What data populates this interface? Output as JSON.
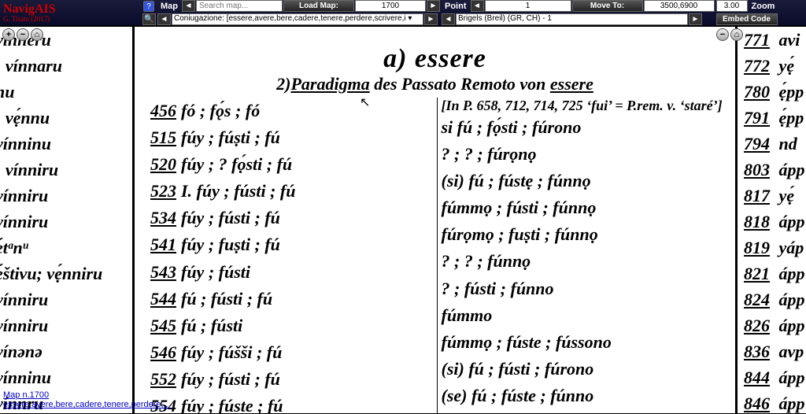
{
  "logo": {
    "title": "NavigAIS",
    "sub": "G. Tisato (2017)"
  },
  "toolbar": {
    "map_label": "Map",
    "search_placeholder": "Search map...",
    "load_map_btn": "Load Map:",
    "map_number": "1700",
    "point_label": "Point",
    "point_value": "1",
    "move_to_btn": "Move To:",
    "coords": "3500,6900",
    "zoom_value": "3.00",
    "zoom_label": "Zoom",
    "select_desc": "Coniugazione: [essere,avere,bere,cadere,tenere,perdere,scrivere,i ▾",
    "select_loc": "Brigels (Breil) (GR, CH) - 1",
    "embed_btn": "Embed Code"
  },
  "center": {
    "title_main": "a) essere",
    "title_sub_prefix": "2)",
    "title_sub_u1": "Paradigma",
    "title_sub_mid": " des Passato Remoto von ",
    "title_sub_u2": "essere",
    "left_rows": [
      {
        "n": "456",
        "t": "fó ; fǫ́s ; fó"
      },
      {
        "n": "515",
        "t": "fúy ; fúṣti ; fú"
      },
      {
        "n": "520",
        "t": "fúy ; ? fọ́sti ; fú"
      },
      {
        "n": "523",
        "t": "I. fúy ; fústi ; fú"
      },
      {
        "n": "534",
        "t": "fúy ; fústi ; fú"
      },
      {
        "n": "541",
        "t": "fúy ; fuṣti ; fú"
      },
      {
        "n": "543",
        "t": "fúy ; fústi"
      },
      {
        "n": "544",
        "t": "fú ; fústi ; fú"
      },
      {
        "n": "545",
        "t": "fú ; fústi"
      },
      {
        "n": "546",
        "t": "fúy ; fúšši ; fú"
      },
      {
        "n": "552",
        "t": "fúy ; fústi ; fú"
      },
      {
        "n": "554",
        "t": "fúy ; fúste ; fú"
      }
    ],
    "right_top": "[In P. 658, 712, 714, 725 ‘fui’ = P.rem. v. ‘staré’]",
    "right_rows": [
      "si fú ; fọ́sti ; fúrono",
      "?   ;   ?   ; fúrọnọ",
      "(si) fú ; fústẹ ; fúnnọ",
      "fúmmọ ; fústi ; fúnnọ",
      "fúrọmọ  ; fuṣti ; fúnnọ",
      "?   ;    ?    ; fúnnọ",
      "?  ;  fústi ; fúnno",
      "fúmmo",
      "fúmmọ ; fúste ; fússono",
      "(si) fú ; fústi ; fúrono",
      "(se) fú ; fúste ; fúnno"
    ]
  },
  "left_panel": [
    "vínneru",
    "; vínnaru",
    "nu",
    "; vẹ́nnu",
    "vínninu",
    "; vínniru",
    "vínniru",
    "vínniru",
    "ẹ́tᵃnᵘ",
    "ẹ́štivu; vẹ́nniru",
    "vínniru",
    "vínniru",
    "vínənə",
    "vínninu",
    "vínnru"
  ],
  "right_panel": [
    {
      "n": "771",
      "t": "avi"
    },
    {
      "n": "772",
      "t": "yẹ́"
    },
    {
      "n": "780",
      "t": "ẹ́pp"
    },
    {
      "n": "791",
      "t": "ẹ́pp"
    },
    {
      "n": "794",
      "t": "nd"
    },
    {
      "n": "803",
      "t": "ápp"
    },
    {
      "n": "817",
      "t": "yẹ́"
    },
    {
      "n": "818",
      "t": "ápp"
    },
    {
      "n": "819",
      "t": "yáp"
    },
    {
      "n": "821",
      "t": "ápp"
    },
    {
      "n": "824",
      "t": "ápp"
    },
    {
      "n": "826",
      "t": "ápp"
    },
    {
      "n": "836",
      "t": "avp"
    },
    {
      "n": "844",
      "t": "ápp"
    },
    {
      "n": "846",
      "t": "ápp"
    }
  ],
  "maplink": {
    "line1": "Map n.1700",
    "line2": "essere,avere,bere,cadere,tenere,perdere,..."
  }
}
